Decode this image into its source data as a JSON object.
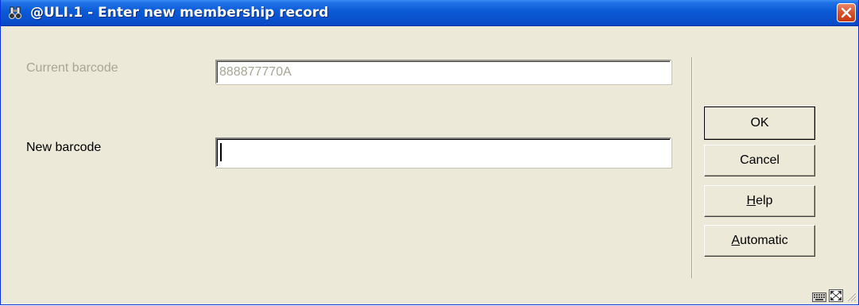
{
  "window": {
    "title": "@ULI.1 - Enter new membership record"
  },
  "form": {
    "current_barcode": {
      "label": "Current barcode",
      "value": "888877770A"
    },
    "new_barcode": {
      "label": "New barcode",
      "value": ""
    }
  },
  "buttons": {
    "ok": "OK",
    "cancel": "Cancel",
    "help_mnemonic": "H",
    "help_rest": "elp",
    "automatic_mnemonic": "A",
    "automatic_rest": "utomatic"
  },
  "icons": {
    "title": "app-binoculars-icon",
    "close": "close-icon",
    "keyboard": "keyboard-icon",
    "maximize": "fullscreen-icon",
    "grip": "resize-grip-icon"
  },
  "colors": {
    "titlebar": "#0a53cf",
    "face": "#ece9d8",
    "disabled_text": "#a7a695",
    "close": "#d9542f"
  }
}
